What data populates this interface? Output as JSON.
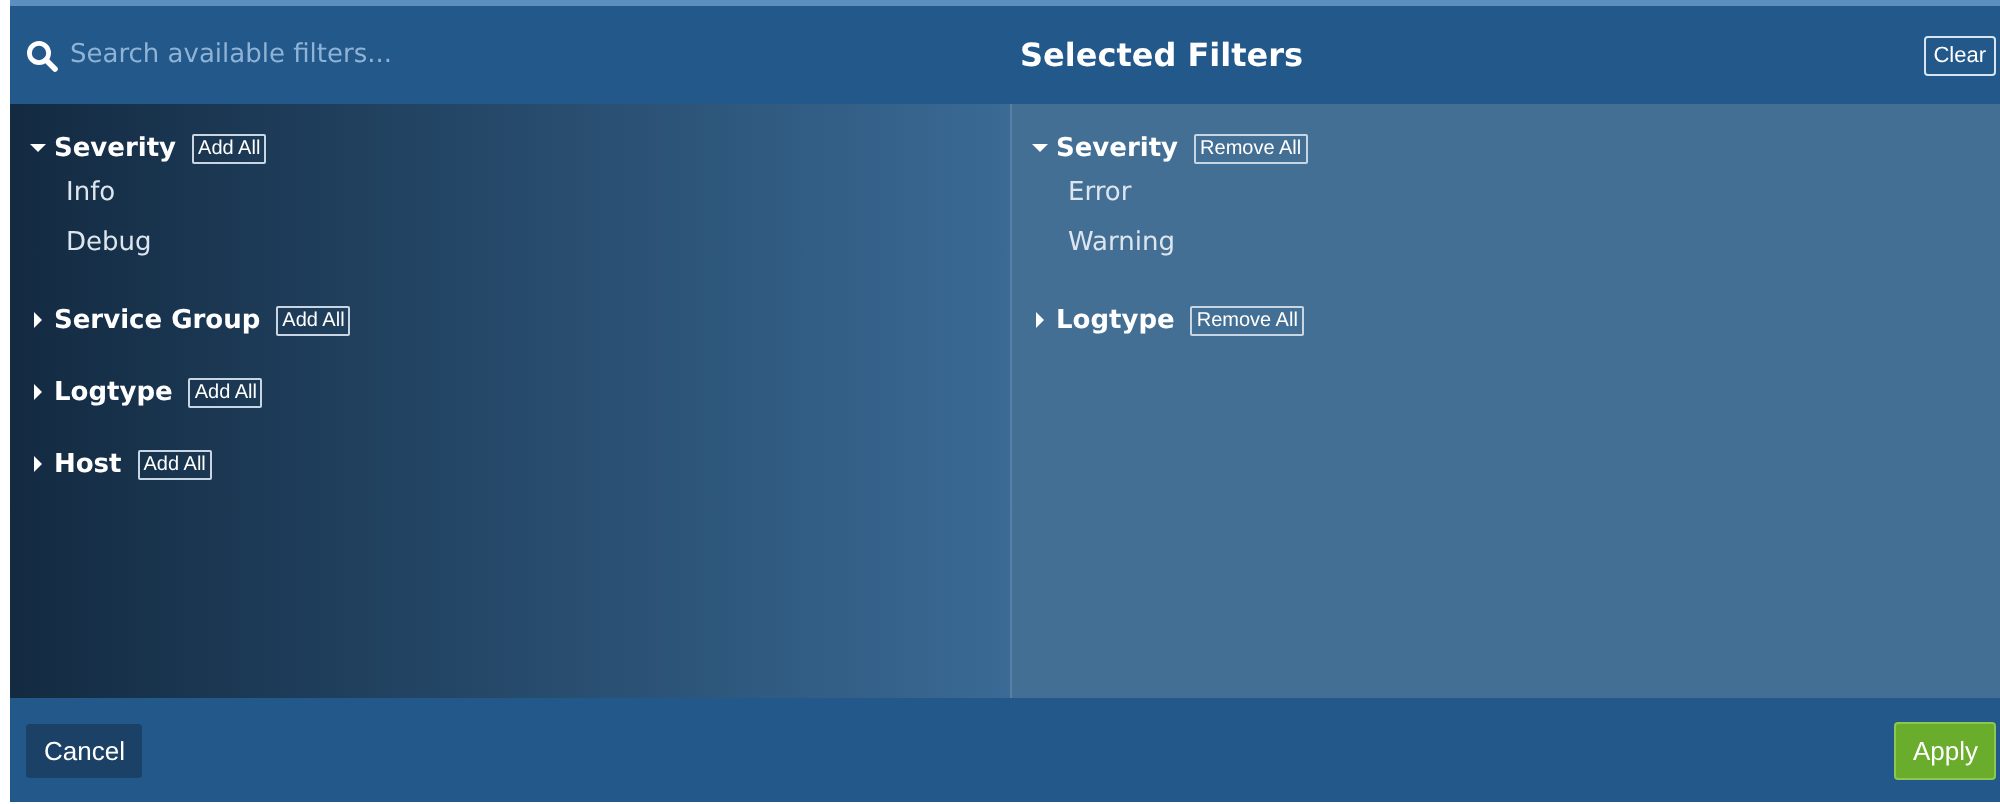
{
  "search": {
    "placeholder": "Search available filters..."
  },
  "selected_title": "Selected Filters",
  "clear_button": "Clear",
  "available_groups": [
    {
      "name": "Severity",
      "action": "Add All",
      "expanded": true,
      "items": [
        "Info",
        "Debug"
      ]
    },
    {
      "name": "Service Group",
      "action": "Add All",
      "expanded": false
    },
    {
      "name": "Logtype",
      "action": "Add All",
      "expanded": false
    },
    {
      "name": "Host",
      "action": "Add All",
      "expanded": false
    }
  ],
  "selected_groups": [
    {
      "name": "Severity",
      "action": "Remove All",
      "expanded": true,
      "items": [
        "Error",
        "Warning"
      ]
    },
    {
      "name": "Logtype",
      "action": "Remove All",
      "expanded": false
    }
  ],
  "buttons": {
    "cancel": "Cancel",
    "apply": "Apply"
  }
}
